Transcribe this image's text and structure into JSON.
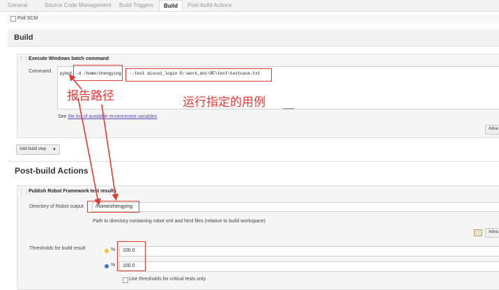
{
  "tabs": [
    "General",
    "Source Code Management",
    "Build Triggers",
    "Build",
    "Post-build Actions"
  ],
  "poll_scm": {
    "label": "Poll SCM",
    "checked": false
  },
  "build": {
    "title": "Build",
    "step": {
      "title": "Execute Windows batch command",
      "command_label": "Command",
      "command_prefix": "pybot",
      "command_outputdir": "-d /home/zhengying",
      "command_test": "--test discuz_login D:\\work_doc\\RF\\test\\testcase.txt",
      "help_prefix": "See ",
      "help_link": "the list of available environment variables",
      "advanced_label": "Adva"
    },
    "add_step_label": "Add build step"
  },
  "annotations": {
    "report_path": "报告路径",
    "run_cases": "运行指定的用例",
    "color": "#e53935"
  },
  "post_build": {
    "title": "Post-build Actions",
    "publisher_title": "Publish Robot Framework test results",
    "output_dir_label": "Directory of Robot output",
    "output_dir_value": "/home/zhengying",
    "output_dir_help": "Path to directory containing robot xml and html files (relative to build workspace)",
    "advanced_label": "Adva",
    "thresholds_label": "Thresholds for build result",
    "unstable_pct_symbol": "%",
    "unstable_value": "100.0",
    "pass_pct_symbol": "%",
    "pass_value": "100.0",
    "critical_only_label": "Use thresholds for critical tests only"
  }
}
